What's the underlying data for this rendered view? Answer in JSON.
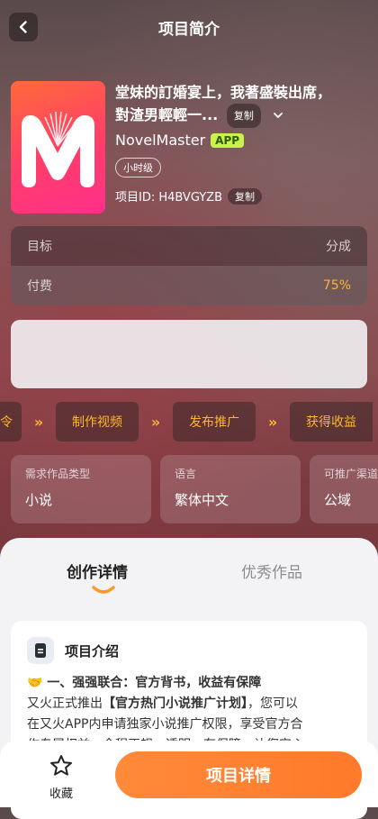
{
  "header": {
    "title": "项目简介"
  },
  "project": {
    "title_line1": "堂妹的訂婚宴上，我著盛裝出席，",
    "title_line2": "對渣男輕輕一...",
    "copy_label": "复制",
    "brand_name": "NovelMaster",
    "brand_badge": "APP",
    "tag": "小时级",
    "id_text": "项目ID: H4BVGYZB",
    "id_copy_label": "复制"
  },
  "stats": {
    "row1_left": "目标",
    "row1_right": "分成",
    "row2_left": "付费",
    "row2_right": "75%"
  },
  "flow": {
    "step0": "令",
    "step1": "制作视频",
    "step2": "发布推广",
    "step3": "获得收益"
  },
  "info": [
    {
      "key": "需求作品类型",
      "value": "小说"
    },
    {
      "key": "语言",
      "value": "繁体中文"
    },
    {
      "key": "可推广渠道",
      "value": "公域"
    }
  ],
  "tabs": {
    "active": "创作详情",
    "inactive": "优秀作品"
  },
  "intro": {
    "title": "项目介绍",
    "heading": "🤝 一、强强联合：官方背书，收益有保障",
    "line1_pre": "又火正式推出",
    "line1_hl": "【官方热门小说推广计划】",
    "line1_post": "，您可以",
    "line2": "在又火APP内申请独家小说推广权限，享受官方合",
    "line3": "作专属权益，全程正规、透明、有保障，让您安心"
  },
  "bottom": {
    "fav_label": "收藏",
    "detail_button": "项目详情"
  },
  "colors": {
    "accent": "#ffb52e",
    "cta": "#ff7f30",
    "badge": "#c9f24a"
  }
}
